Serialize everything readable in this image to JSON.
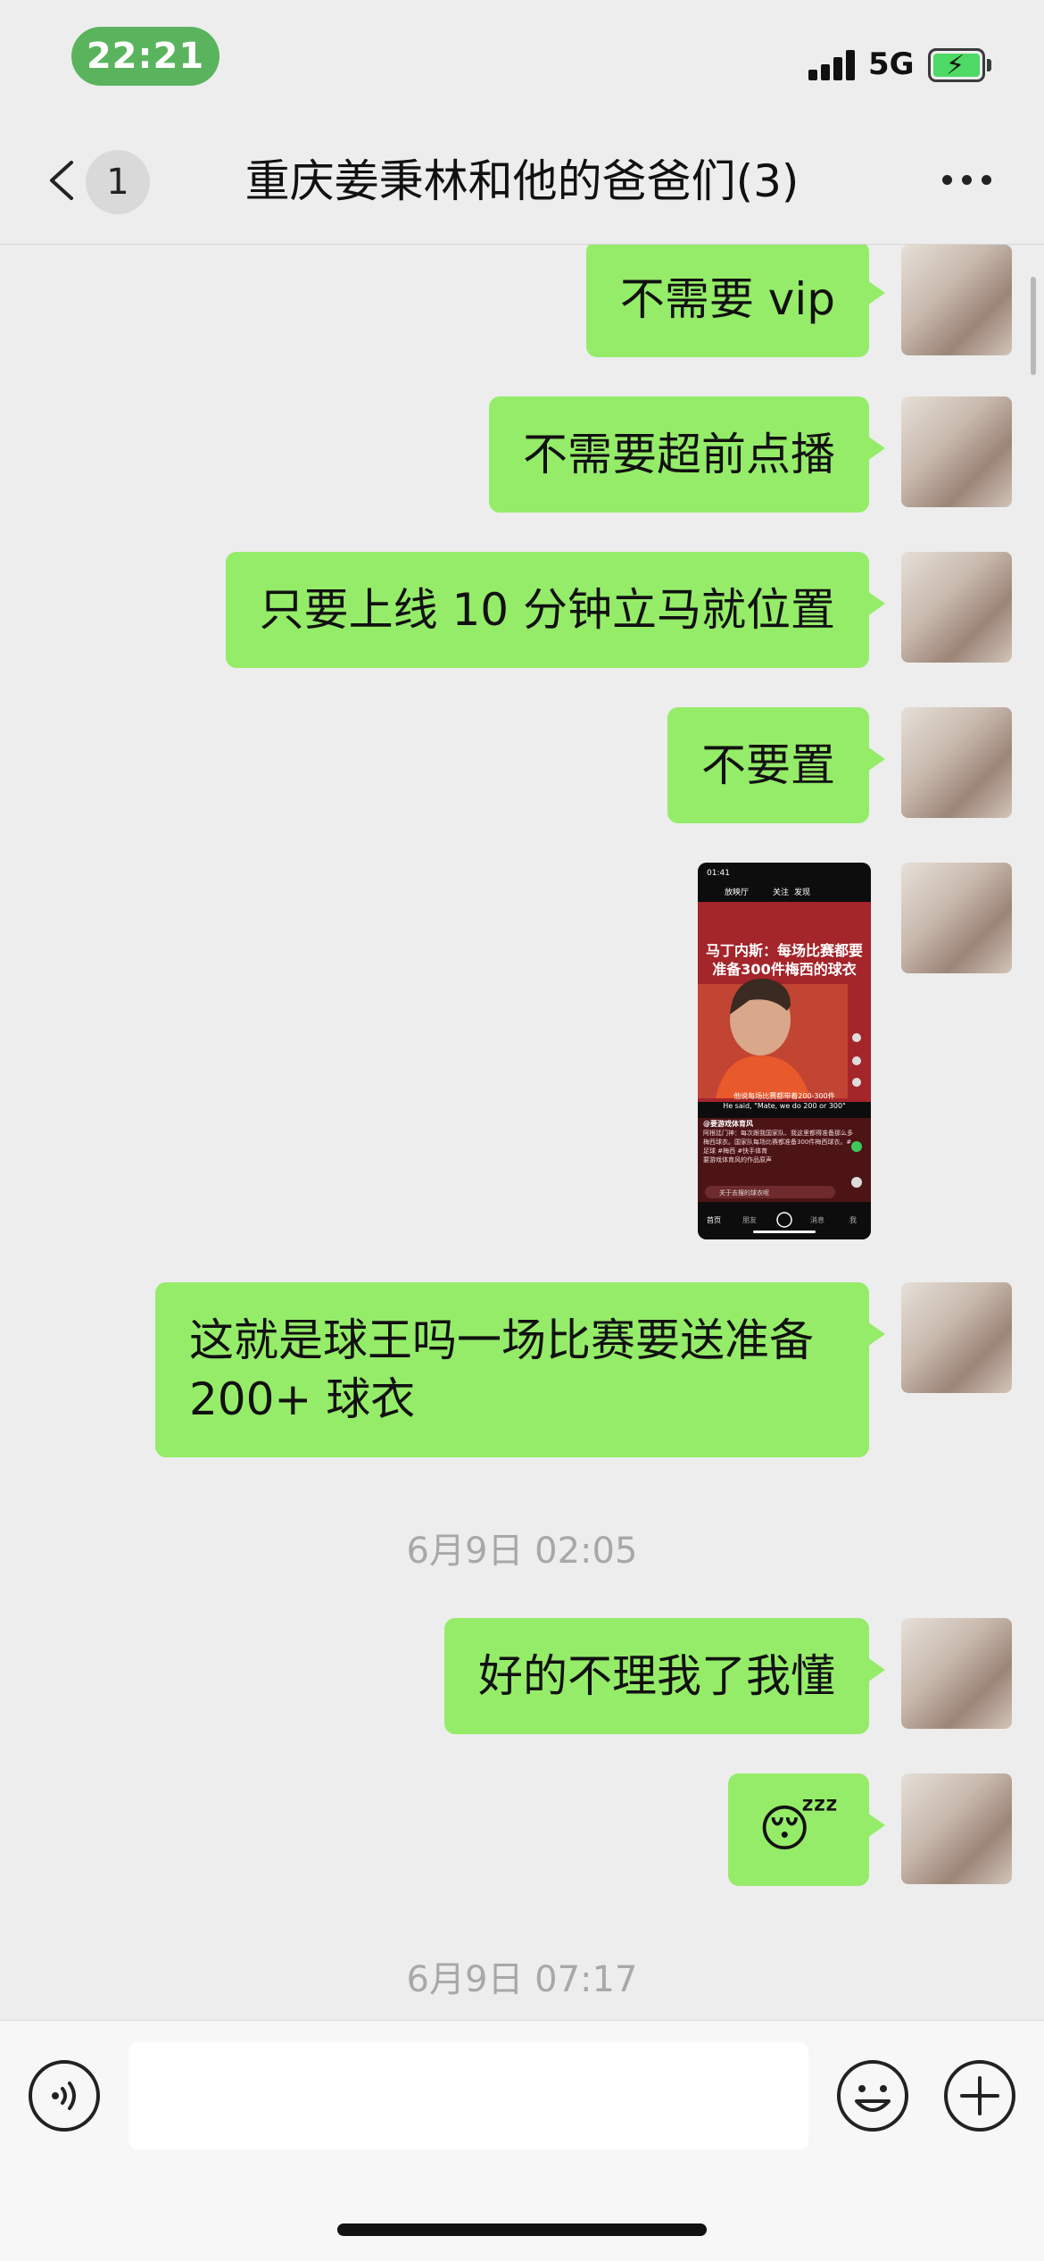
{
  "status_bar": {
    "time": "22:21",
    "network": "5G",
    "battery_state": "charging"
  },
  "nav": {
    "unread_count": "1",
    "title": "重庆姜秉林和他的爸爸们(3)"
  },
  "messages": [
    {
      "type": "text",
      "text": "不需要 vip"
    },
    {
      "type": "text",
      "text": "不需要超前点播"
    },
    {
      "type": "text",
      "text": "只要上线 10 分钟立马就位置"
    },
    {
      "type": "text",
      "text": "不要置"
    },
    {
      "type": "video",
      "thumb": {
        "time": "01:41",
        "tabs": [
          "放映厅",
          "关注",
          "发现"
        ],
        "headline": "马丁内斯：每场比赛都要准备300件梅西的球衣",
        "caption_cn": "他说每场比赛都带着200-300件",
        "caption_en": "He said, \"Mate, we do 200 or 300\"",
        "account": "@要游戏体育风",
        "description": "阿根廷门神：每次跟我国家队、我这里都得准备那么多梅西球衣。国家队每场比赛都准备300件梅西球衣。#足球 #梅西 #快手体育",
        "music": "要游戏体育风的作品原声",
        "comment_hint": "关于去搜的球衣呢",
        "bottom_tabs": [
          "首页",
          "朋友",
          "消息",
          "我"
        ]
      }
    },
    {
      "type": "text",
      "text": "这就是球王吗一场比赛要送准备 200+ 球衣"
    },
    {
      "type": "timestamp",
      "text": "6月9日 02:05"
    },
    {
      "type": "text",
      "text": "好的不理我了我懂"
    },
    {
      "type": "emoji",
      "text": "😴"
    },
    {
      "type": "timestamp",
      "text": "6月9日 07:17"
    }
  ],
  "input": {
    "placeholder": ""
  },
  "colors": {
    "bubble": "#95ec69",
    "background": "#ededed",
    "time_pill": "#5ab45e",
    "battery": "#4cd964"
  }
}
